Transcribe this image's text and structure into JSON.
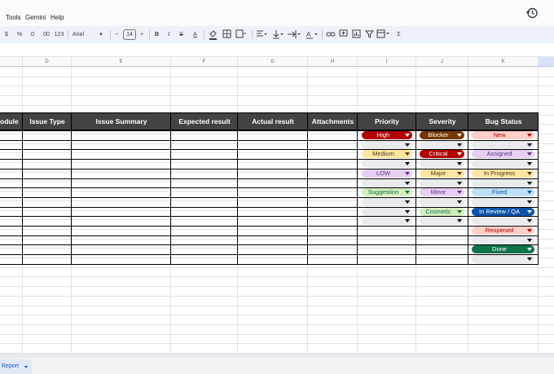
{
  "menu": [
    "Tools",
    "Gemini",
    "Help"
  ],
  "toolbar": {
    "items": [
      "$",
      "%",
      ".0",
      ".00",
      "123",
      "Arial",
      "−",
      "14",
      "+",
      "B",
      "I",
      "S",
      "A",
      "Σ"
    ],
    "font_name": "Arial",
    "font_size": "14"
  },
  "columns": [
    "D",
    "E",
    "F",
    "G",
    "H",
    "I",
    "J",
    "K"
  ],
  "header": {
    "module": "odule",
    "issue_type": "Issue Type",
    "issue_summary": "Issue Summary",
    "expected_result": "Expected result",
    "actual_result": "Actual result",
    "attachments": "Attachments",
    "priority": "Priority",
    "severity": "Severity",
    "bug_status": "Bug Status"
  },
  "priority_chips": [
    {
      "label": "High",
      "bg": "#b10202",
      "fg": "#ffffff",
      "arrow": "#ffffff"
    },
    {
      "label": "",
      "bg": "#e8eaed",
      "fg": "#202124",
      "arrow": "#000000"
    },
    {
      "label": "Medium",
      "bg": "#ffe5a0",
      "fg": "#473821",
      "arrow": "#473821"
    },
    {
      "label": "",
      "bg": "#e8eaed",
      "fg": "#202124",
      "arrow": "#000000"
    },
    {
      "label": "LOW",
      "bg": "#e6cff2",
      "fg": "#5a3286",
      "arrow": "#5a3286"
    },
    {
      "label": "",
      "bg": "#e8eaed",
      "fg": "#202124",
      "arrow": "#000000"
    },
    {
      "label": "Suggestion",
      "bg": "#d4edbc",
      "fg": "#11734b",
      "arrow": "#11734b"
    },
    {
      "label": "",
      "bg": "#e8eaed",
      "fg": "#202124",
      "arrow": "#000000"
    },
    {
      "label": "",
      "bg": "#e8eaed",
      "fg": "#202124",
      "arrow": "#000000"
    },
    {
      "label": "",
      "bg": "#e8eaed",
      "fg": "#202124",
      "arrow": "#000000"
    }
  ],
  "severity_chips": [
    {
      "label": "Blocker",
      "bg": "#753800",
      "fg": "#ffffff",
      "arrow": "#ffffff"
    },
    {
      "label": "",
      "bg": "#e8eaed",
      "fg": "#202124",
      "arrow": "#000000"
    },
    {
      "label": "Critical",
      "bg": "#b10202",
      "fg": "#ffffff",
      "arrow": "#ffffff"
    },
    {
      "label": "",
      "bg": "#e8eaed",
      "fg": "#202124",
      "arrow": "#000000"
    },
    {
      "label": "Major",
      "bg": "#ffe5a0",
      "fg": "#473821",
      "arrow": "#473821"
    },
    {
      "label": "",
      "bg": "#e8eaed",
      "fg": "#202124",
      "arrow": "#000000"
    },
    {
      "label": "Minor",
      "bg": "#e6cff2",
      "fg": "#5a3286",
      "arrow": "#5a3286"
    },
    {
      "label": "",
      "bg": "#e8eaed",
      "fg": "#202124",
      "arrow": "#000000"
    },
    {
      "label": "Cosmetic",
      "bg": "#d4edbc",
      "fg": "#11734b",
      "arrow": "#11734b"
    },
    {
      "label": "",
      "bg": "#e8eaed",
      "fg": "#202124",
      "arrow": "#000000"
    }
  ],
  "status_chips": [
    {
      "label": "New",
      "bg": "#ffcfc9",
      "fg": "#b10202",
      "arrow": "#b10202"
    },
    {
      "label": "",
      "bg": "#e8eaed",
      "fg": "#202124",
      "arrow": "#000000"
    },
    {
      "label": "Assigned",
      "bg": "#e6cff2",
      "fg": "#5a3286",
      "arrow": "#5a3286"
    },
    {
      "label": "",
      "bg": "#e8eaed",
      "fg": "#202124",
      "arrow": "#000000"
    },
    {
      "label": "In Progress",
      "bg": "#ffe5a0",
      "fg": "#473821",
      "arrow": "#473821"
    },
    {
      "label": "",
      "bg": "#e8eaed",
      "fg": "#202124",
      "arrow": "#000000"
    },
    {
      "label": "Fixed",
      "bg": "#bfe1f6",
      "fg": "#0a53a8",
      "arrow": "#0a53a8"
    },
    {
      "label": "",
      "bg": "#e8eaed",
      "fg": "#202124",
      "arrow": "#000000"
    },
    {
      "label": "In Review / QA",
      "bg": "#0a53a8",
      "fg": "#ffffff",
      "arrow": "#ffffff"
    },
    {
      "label": "",
      "bg": "#e8eaed",
      "fg": "#202124",
      "arrow": "#000000"
    },
    {
      "label": "Reopened",
      "bg": "#ffcfc9",
      "fg": "#b10202",
      "arrow": "#b10202"
    },
    {
      "label": "",
      "bg": "#e8eaed",
      "fg": "#202124",
      "arrow": "#000000"
    },
    {
      "label": "Done",
      "bg": "#11734b",
      "fg": "#ffffff",
      "arrow": "#ffffff"
    },
    {
      "label": "",
      "bg": "#e8eaed",
      "fg": "#202124",
      "arrow": "#000000"
    }
  ],
  "sheet_tab": "Report"
}
